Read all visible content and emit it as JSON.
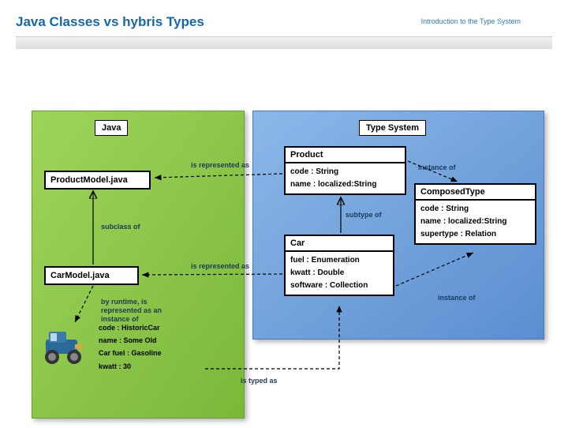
{
  "header": {
    "title": "Java Classes vs hybris Types",
    "subtitle": "Introduction to the Type System"
  },
  "panels": {
    "java_label": "Java",
    "type_label": "Type System"
  },
  "java_boxes": {
    "product_model": "ProductModel.java",
    "car_model": "CarModel.java"
  },
  "types": {
    "product": {
      "name": "Product",
      "attrs": [
        "code : String",
        "name : localized:String"
      ]
    },
    "car": {
      "name": "Car",
      "attrs": [
        "fuel : Enumeration",
        "kwatt : Double",
        "software : Collection"
      ]
    },
    "composed": {
      "name": "ComposedType",
      "attrs": [
        "code : String",
        "name : localized:String",
        "supertype : Relation"
      ]
    }
  },
  "edges": {
    "repr1": "is represented as",
    "repr2": "is represented as",
    "subclass": "subclass of",
    "subtype": "subtype of",
    "instance1": "instance of",
    "instance2": "instance of",
    "runtime": "by runtime, is represented as an instance of",
    "typed_as": "is typed as"
  },
  "instance": {
    "a0": "code : HistoricCar",
    "a1": "name : Some Old",
    "a2": "Car fuel : Gasoline",
    "a3": "kwatt : 30"
  }
}
